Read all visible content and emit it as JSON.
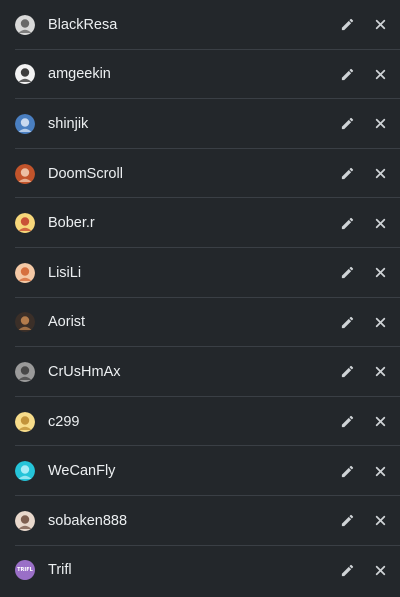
{
  "users": [
    {
      "name": "BlackResa",
      "avatar_icon": "black-cat-avatar-icon",
      "avatar_bg": "#d9d9d9",
      "avatar_fg": "#555555"
    },
    {
      "name": "amgeekin",
      "avatar_icon": "masked-face-avatar-icon",
      "avatar_bg": "#f2f2f2",
      "avatar_fg": "#1c1c1c"
    },
    {
      "name": "shinjik",
      "avatar_icon": "anime-character-avatar-icon",
      "avatar_bg": "#4a7fc1",
      "avatar_fg": "#dfe9f7"
    },
    {
      "name": "DoomScroll",
      "avatar_icon": "fox-avatar-icon",
      "avatar_bg": "#c2542b",
      "avatar_fg": "#f3d2b8"
    },
    {
      "name": "Bober.r",
      "avatar_icon": "cartoon-face-avatar-icon",
      "avatar_bg": "#f7d77a",
      "avatar_fg": "#c1392b"
    },
    {
      "name": "LisiLi",
      "avatar_icon": "fox-face-avatar-icon",
      "avatar_bg": "#f4c9a6",
      "avatar_fg": "#d0602d"
    },
    {
      "name": "Aorist",
      "avatar_icon": "dark-figure-avatar-icon",
      "avatar_bg": "#3b2f28",
      "avatar_fg": "#c98a52"
    },
    {
      "name": "CrUsHmAx",
      "avatar_icon": "grey-cat-avatar-icon",
      "avatar_bg": "#9a9a9a",
      "avatar_fg": "#3a3a3a"
    },
    {
      "name": "c299",
      "avatar_icon": "cartoon-character-avatar-icon",
      "avatar_bg": "#f7dc8a",
      "avatar_fg": "#b8862b"
    },
    {
      "name": "WeCanFly",
      "avatar_icon": "cyan-pattern-avatar-icon",
      "avatar_bg": "#25c4d9",
      "avatar_fg": "#bff3fb"
    },
    {
      "name": "sobaken888",
      "avatar_icon": "dog-avatar-icon",
      "avatar_bg": "#e8d8cc",
      "avatar_fg": "#6b4a3a"
    },
    {
      "name": "Trifl",
      "avatar_icon": "trifl-logo-avatar-icon",
      "avatar_bg": "#9a6fc7",
      "avatar_fg": "#ffffff",
      "avatar_text": "TRIFL"
    }
  ],
  "icons": {
    "edit": "pencil-icon",
    "delete": "close-icon"
  },
  "colors": {
    "background": "#23272b",
    "divider": "#3a3f45",
    "text": "#eceff1",
    "icon": "#cfd3d6"
  }
}
